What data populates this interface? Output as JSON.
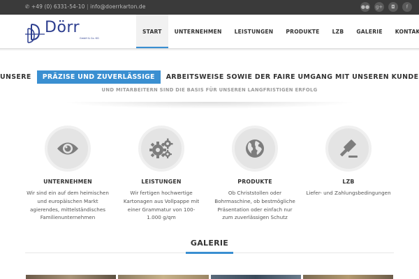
{
  "topbar": {
    "phone": "+49 (0) 6331-54-10",
    "separator": "|",
    "email": "info@doerrkarton.de",
    "socials": [
      {
        "icon": "flickr-icon",
        "glyph": "●●"
      },
      {
        "icon": "google-plus-icon",
        "glyph": "g+"
      },
      {
        "icon": "instagram-icon",
        "glyph": "◘"
      },
      {
        "icon": "facebook-icon",
        "glyph": "f"
      }
    ]
  },
  "header": {
    "logo_text": "Dörr",
    "logo_sub": "GmbH & Co. KG",
    "nav": [
      {
        "label": "START",
        "active": true
      },
      {
        "label": "UNTERNEHMEN",
        "active": false
      },
      {
        "label": "LEISTUNGEN",
        "active": false
      },
      {
        "label": "PRODUKTE",
        "active": false
      },
      {
        "label": "LZB",
        "active": false
      },
      {
        "label": "GALERIE",
        "active": false
      },
      {
        "label": "KONTAKT",
        "active": false
      }
    ]
  },
  "tagline": {
    "before": "UNSERE",
    "highlight": "PRÄZISE UND ZUVERLÄSSIGE",
    "after": "ARBEITSWEISE SOWIE DER FAIRE UMGANG MIT UNSEREN KUNDEN",
    "subline": "UND MITARBEITERN SIND DIE BASIS FÜR UNSEREN LANGFRISTIGEN ERFOLG"
  },
  "features": [
    {
      "icon": "eye-icon",
      "title": "UNTERNEHMEN",
      "desc": "Wir sind ein auf dem heimischen und europäischen Markt agierendes, mittelständisches Familienunternehmen"
    },
    {
      "icon": "gears-icon",
      "title": "LEISTUNGEN",
      "desc": "Wir fertigen hochwertige Kartonagen aus Vollpappe mit einer Grammatur von 100-1.000 g/qm"
    },
    {
      "icon": "globe-icon",
      "title": "PRODUKTE",
      "desc": "Ob Christstollen oder Bohrmaschine, ob bestmögliche Präsentation oder einfach nur zum zuverlässigen Schutz"
    },
    {
      "icon": "gavel-icon",
      "title": "LZB",
      "desc": "Liefer- und Zahlungsbedingungen"
    }
  ],
  "galerie": {
    "title": "GALERIE"
  },
  "colors": {
    "accent": "#3a8fd1",
    "topbar": "#3a3a3a",
    "brand": "#2d3e8f",
    "icon_circle": "#e4e4e4",
    "icon_glyph": "#7d7d7d"
  }
}
